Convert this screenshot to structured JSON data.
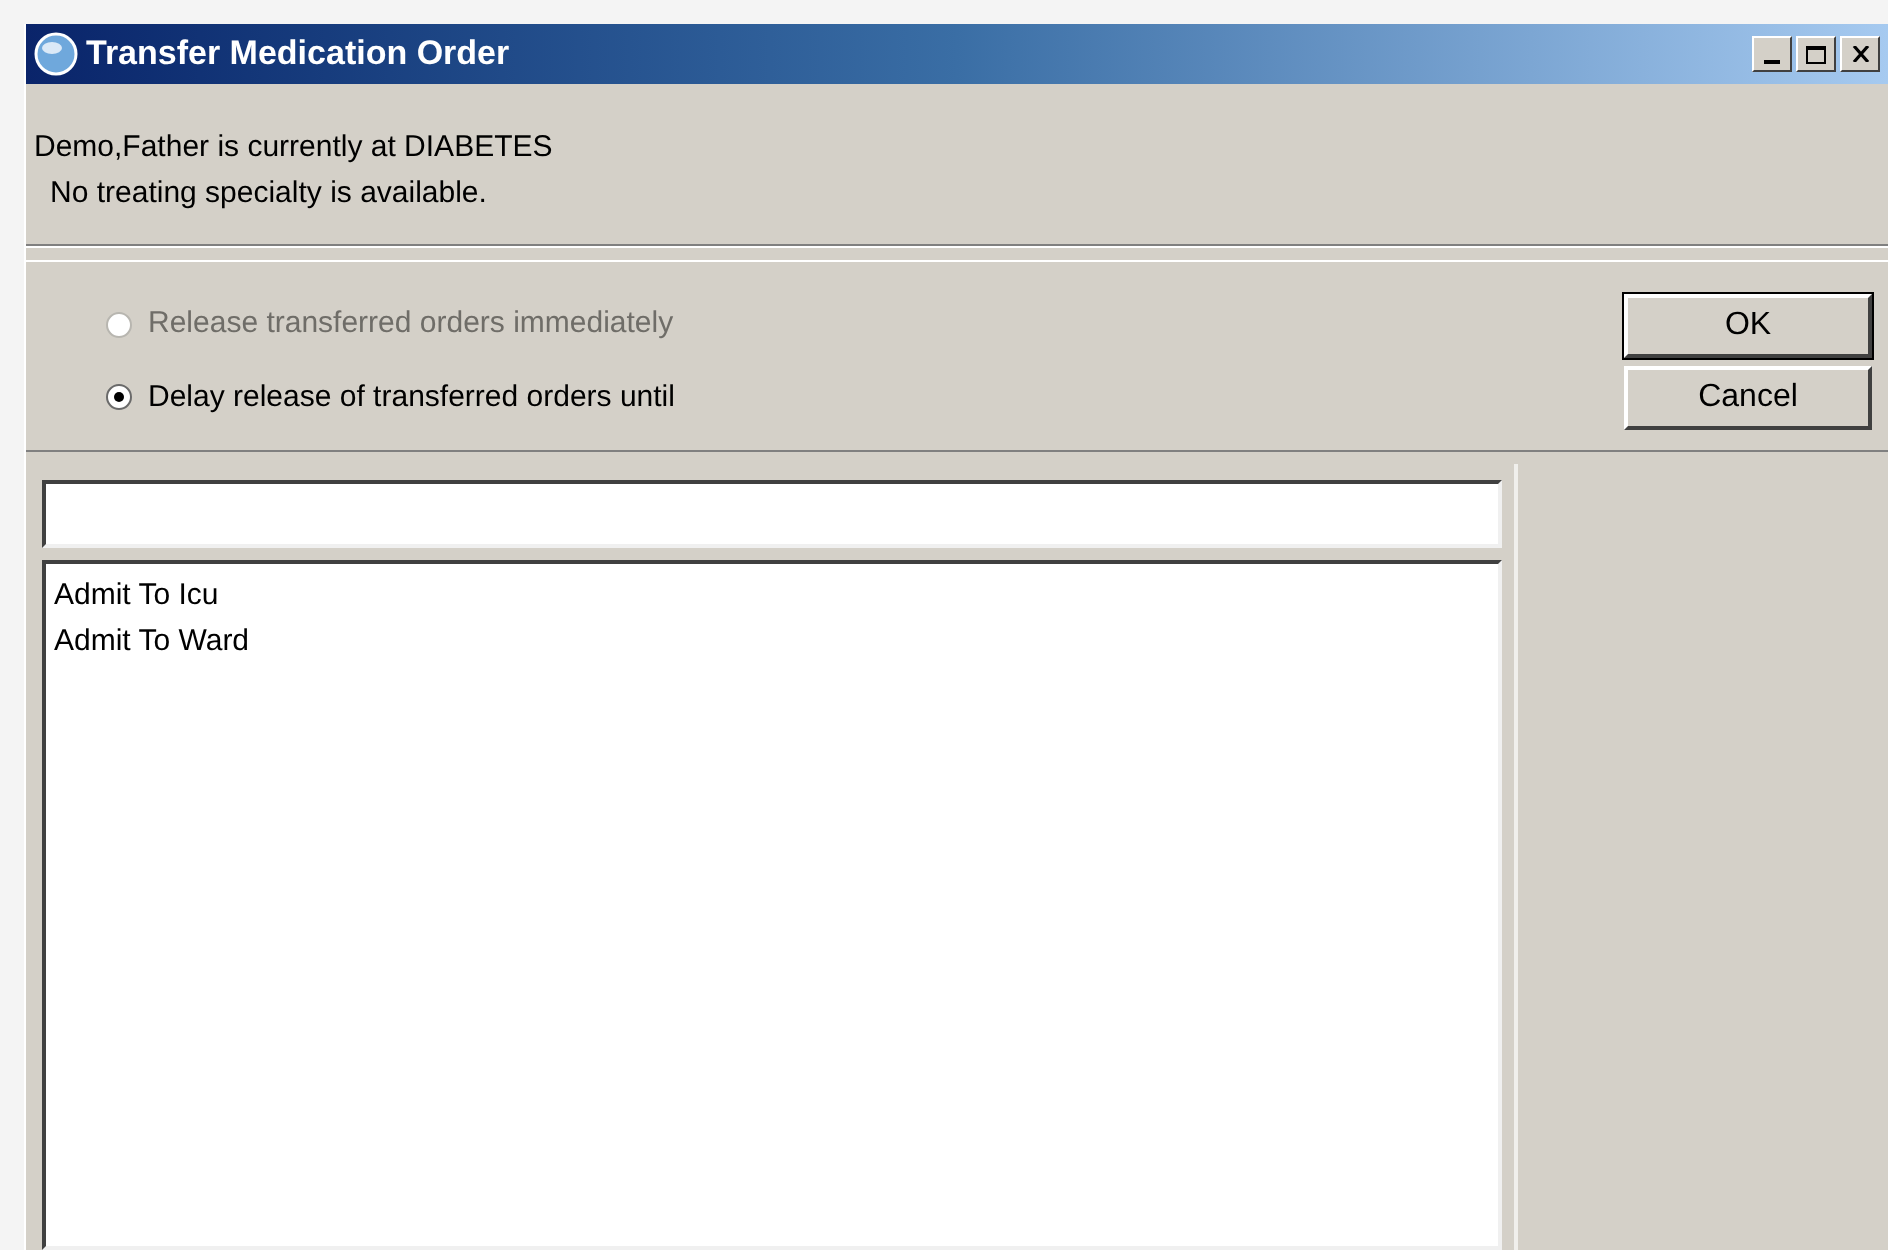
{
  "window": {
    "title": "Transfer Medication Order"
  },
  "info": {
    "patient_line": "Demo,Father is currently at DIABETES",
    "specialty_line": "No treating specialty is available."
  },
  "release_options": [
    {
      "label": "Release transferred orders immediately",
      "selected": false,
      "disabled": true
    },
    {
      "label": "Delay release of transferred orders until",
      "selected": true,
      "disabled": false
    }
  ],
  "buttons": [
    {
      "label": "OK",
      "default": true
    },
    {
      "label": "Cancel",
      "default": false
    }
  ],
  "location_list": {
    "items": [
      {
        "label": "Admit To Icu",
        "selected": false
      },
      {
        "label": "Admit To Ward",
        "selected": false
      }
    ]
  }
}
